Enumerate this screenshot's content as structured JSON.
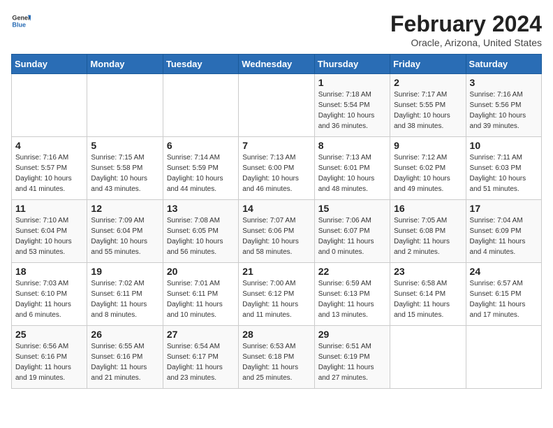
{
  "header": {
    "logo_general": "General",
    "logo_blue": "Blue",
    "title": "February 2024",
    "subtitle": "Oracle, Arizona, United States"
  },
  "calendar": {
    "days_of_week": [
      "Sunday",
      "Monday",
      "Tuesday",
      "Wednesday",
      "Thursday",
      "Friday",
      "Saturday"
    ],
    "weeks": [
      [
        {
          "day": "",
          "info": ""
        },
        {
          "day": "",
          "info": ""
        },
        {
          "day": "",
          "info": ""
        },
        {
          "day": "",
          "info": ""
        },
        {
          "day": "1",
          "info": "Sunrise: 7:18 AM\nSunset: 5:54 PM\nDaylight: 10 hours\nand 36 minutes."
        },
        {
          "day": "2",
          "info": "Sunrise: 7:17 AM\nSunset: 5:55 PM\nDaylight: 10 hours\nand 38 minutes."
        },
        {
          "day": "3",
          "info": "Sunrise: 7:16 AM\nSunset: 5:56 PM\nDaylight: 10 hours\nand 39 minutes."
        }
      ],
      [
        {
          "day": "4",
          "info": "Sunrise: 7:16 AM\nSunset: 5:57 PM\nDaylight: 10 hours\nand 41 minutes."
        },
        {
          "day": "5",
          "info": "Sunrise: 7:15 AM\nSunset: 5:58 PM\nDaylight: 10 hours\nand 43 minutes."
        },
        {
          "day": "6",
          "info": "Sunrise: 7:14 AM\nSunset: 5:59 PM\nDaylight: 10 hours\nand 44 minutes."
        },
        {
          "day": "7",
          "info": "Sunrise: 7:13 AM\nSunset: 6:00 PM\nDaylight: 10 hours\nand 46 minutes."
        },
        {
          "day": "8",
          "info": "Sunrise: 7:13 AM\nSunset: 6:01 PM\nDaylight: 10 hours\nand 48 minutes."
        },
        {
          "day": "9",
          "info": "Sunrise: 7:12 AM\nSunset: 6:02 PM\nDaylight: 10 hours\nand 49 minutes."
        },
        {
          "day": "10",
          "info": "Sunrise: 7:11 AM\nSunset: 6:03 PM\nDaylight: 10 hours\nand 51 minutes."
        }
      ],
      [
        {
          "day": "11",
          "info": "Sunrise: 7:10 AM\nSunset: 6:04 PM\nDaylight: 10 hours\nand 53 minutes."
        },
        {
          "day": "12",
          "info": "Sunrise: 7:09 AM\nSunset: 6:04 PM\nDaylight: 10 hours\nand 55 minutes."
        },
        {
          "day": "13",
          "info": "Sunrise: 7:08 AM\nSunset: 6:05 PM\nDaylight: 10 hours\nand 56 minutes."
        },
        {
          "day": "14",
          "info": "Sunrise: 7:07 AM\nSunset: 6:06 PM\nDaylight: 10 hours\nand 58 minutes."
        },
        {
          "day": "15",
          "info": "Sunrise: 7:06 AM\nSunset: 6:07 PM\nDaylight: 11 hours\nand 0 minutes."
        },
        {
          "day": "16",
          "info": "Sunrise: 7:05 AM\nSunset: 6:08 PM\nDaylight: 11 hours\nand 2 minutes."
        },
        {
          "day": "17",
          "info": "Sunrise: 7:04 AM\nSunset: 6:09 PM\nDaylight: 11 hours\nand 4 minutes."
        }
      ],
      [
        {
          "day": "18",
          "info": "Sunrise: 7:03 AM\nSunset: 6:10 PM\nDaylight: 11 hours\nand 6 minutes."
        },
        {
          "day": "19",
          "info": "Sunrise: 7:02 AM\nSunset: 6:11 PM\nDaylight: 11 hours\nand 8 minutes."
        },
        {
          "day": "20",
          "info": "Sunrise: 7:01 AM\nSunset: 6:11 PM\nDaylight: 11 hours\nand 10 minutes."
        },
        {
          "day": "21",
          "info": "Sunrise: 7:00 AM\nSunset: 6:12 PM\nDaylight: 11 hours\nand 11 minutes."
        },
        {
          "day": "22",
          "info": "Sunrise: 6:59 AM\nSunset: 6:13 PM\nDaylight: 11 hours\nand 13 minutes."
        },
        {
          "day": "23",
          "info": "Sunrise: 6:58 AM\nSunset: 6:14 PM\nDaylight: 11 hours\nand 15 minutes."
        },
        {
          "day": "24",
          "info": "Sunrise: 6:57 AM\nSunset: 6:15 PM\nDaylight: 11 hours\nand 17 minutes."
        }
      ],
      [
        {
          "day": "25",
          "info": "Sunrise: 6:56 AM\nSunset: 6:16 PM\nDaylight: 11 hours\nand 19 minutes."
        },
        {
          "day": "26",
          "info": "Sunrise: 6:55 AM\nSunset: 6:16 PM\nDaylight: 11 hours\nand 21 minutes."
        },
        {
          "day": "27",
          "info": "Sunrise: 6:54 AM\nSunset: 6:17 PM\nDaylight: 11 hours\nand 23 minutes."
        },
        {
          "day": "28",
          "info": "Sunrise: 6:53 AM\nSunset: 6:18 PM\nDaylight: 11 hours\nand 25 minutes."
        },
        {
          "day": "29",
          "info": "Sunrise: 6:51 AM\nSunset: 6:19 PM\nDaylight: 11 hours\nand 27 minutes."
        },
        {
          "day": "",
          "info": ""
        },
        {
          "day": "",
          "info": ""
        }
      ]
    ]
  }
}
